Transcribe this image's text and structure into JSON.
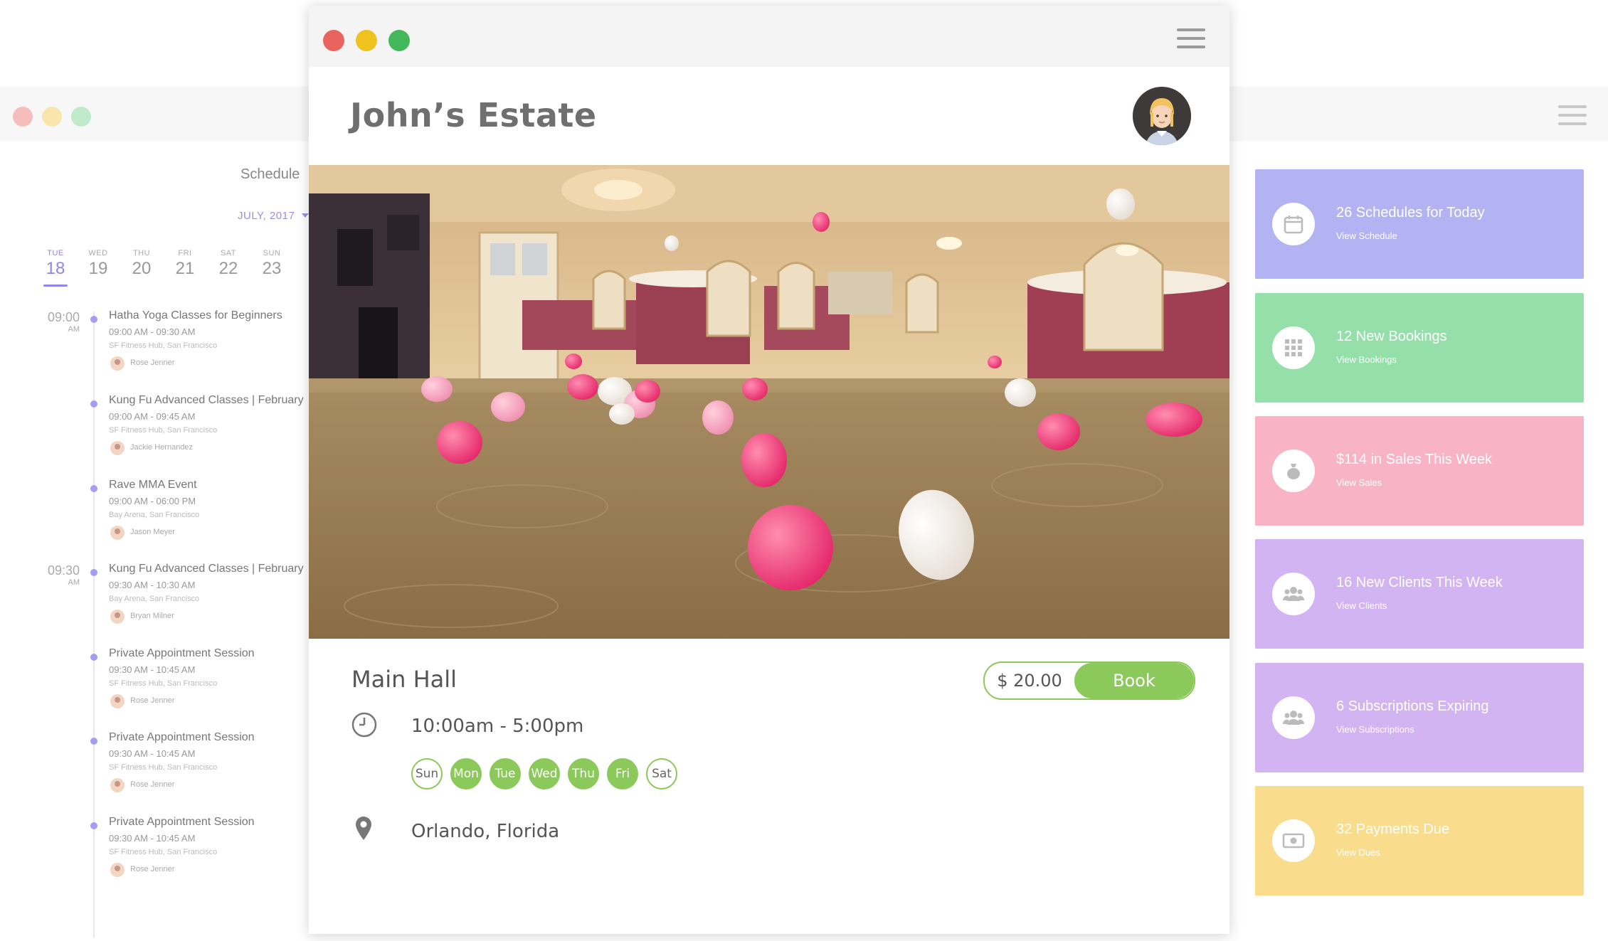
{
  "back_window": {
    "colors": {
      "close": "#f08a85",
      "minimize": "#f5d36b",
      "maximize": "#8fd9a0"
    }
  },
  "schedule": {
    "title": "Schedule",
    "month": "JULY, 2017",
    "days": [
      {
        "name": "TUE",
        "date": "18",
        "active": true
      },
      {
        "name": "WED",
        "date": "19"
      },
      {
        "name": "THU",
        "date": "20"
      },
      {
        "name": "FRI",
        "date": "21"
      },
      {
        "name": "SAT",
        "date": "22"
      },
      {
        "name": "SUN",
        "date": "23"
      }
    ],
    "times": [
      {
        "time": "09:00",
        "ampm": "AM"
      },
      {
        "time": "09:30",
        "ampm": "AM"
      }
    ],
    "events": [
      {
        "title": "Hatha Yoga Classes for Beginners",
        "time": "09:00 AM - 09:30 AM",
        "location": "SF Fitness Hub, San Francisco",
        "person": "Rose Jenner"
      },
      {
        "title": "Kung Fu Advanced Classes | February",
        "time": "09:00 AM - 09:45 AM",
        "location": "SF Fitness Hub, San Francisco",
        "person": "Jackie Hernandez"
      },
      {
        "title": "Rave MMA Event",
        "time": "09:00 AM - 06:00 PM",
        "location": "Bay Arena, San Francisco",
        "person": "Jason Meyer"
      },
      {
        "title": "Kung Fu Advanced Classes | February",
        "time": "09:30 AM - 10:30 AM",
        "location": "Bay Arena, San Francisco",
        "person": "Bryan Milner"
      },
      {
        "title": "Private Appointment Session",
        "time": "09:30 AM - 10:45 AM",
        "location": "SF Fitness Hub, San Francisco",
        "person": "Rose Jenner"
      },
      {
        "title": "Private Appointment Session",
        "time": "09:30 AM - 10:45 AM",
        "location": "SF Fitness Hub, San Francisco",
        "person": "Rose Jenner"
      },
      {
        "title": "Private Appointment Session",
        "time": "09:30 AM - 10:45 AM",
        "location": "SF Fitness Hub, San Francisco",
        "person": "Rose Jenner"
      }
    ]
  },
  "stats": [
    {
      "title": "26 Schedules for Today",
      "link": "View Schedule",
      "color": "#b3b3f3",
      "icon": "calendar-icon"
    },
    {
      "title": "12 New Bookings",
      "link": "View Bookings",
      "color": "#95dfaa",
      "icon": "grid-icon"
    },
    {
      "title": "$114 in Sales This Week",
      "link": "View Sales",
      "color": "#f8b4c4",
      "icon": "money-bag-icon"
    },
    {
      "title": "16 New Clients This Week",
      "link": "View Clients",
      "color": "#d3b4f2",
      "icon": "users-icon"
    },
    {
      "title": "6 Subscriptions Expiring",
      "link": "View Subscriptions",
      "color": "#d3b4f2",
      "icon": "users-icon"
    },
    {
      "title": "32 Payments Due",
      "link": "View Dues",
      "color": "#f9dd8c",
      "icon": "banknote-icon"
    }
  ],
  "front_window": {
    "colors": {
      "close": "#e9645e",
      "minimize": "#efc21e",
      "maximize": "#44b75a"
    },
    "venue_title": "John’s Estate",
    "hall_name": "Main Hall",
    "price": "$ 20.00",
    "book_label": "Book",
    "hours": "10:00am - 5:00pm",
    "week_days": [
      {
        "label": "Sun",
        "available": false
      },
      {
        "label": "Mon",
        "available": true
      },
      {
        "label": "Tue",
        "available": true
      },
      {
        "label": "Wed",
        "available": true
      },
      {
        "label": "Thu",
        "available": true
      },
      {
        "label": "Fri",
        "available": true
      },
      {
        "label": "Sat",
        "available": false
      }
    ],
    "location": "Orlando, Florida",
    "accent_color": "#8bc95a"
  }
}
